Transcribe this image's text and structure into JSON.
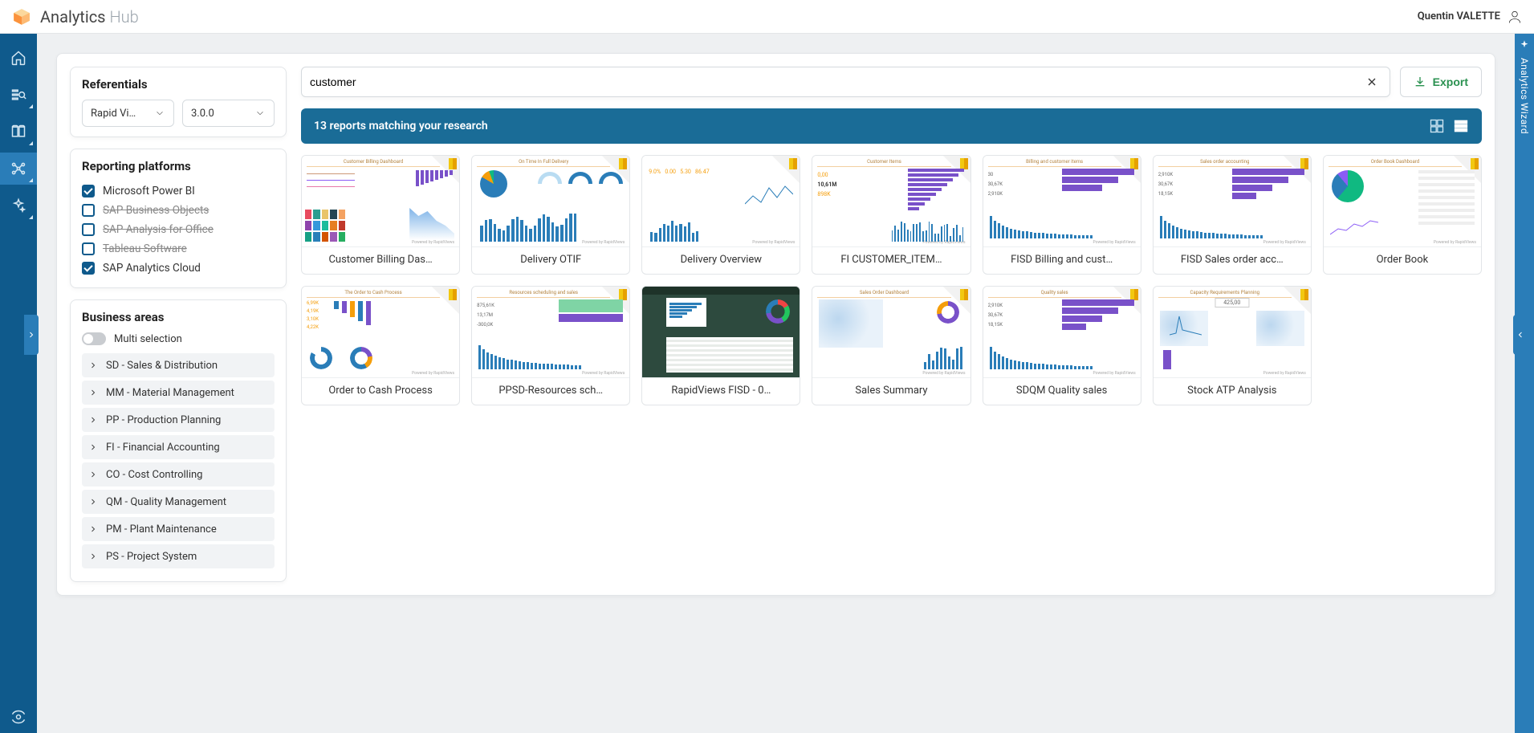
{
  "app": {
    "title_main": "Analytics",
    "title_sub": "Hub"
  },
  "user": {
    "name": "Quentin VALETTE"
  },
  "right_panel": {
    "label": "Analytics Wizard"
  },
  "sidebar": {
    "referentials": {
      "title": "Referentials",
      "select1": "Rapid Vi…",
      "select2": "3.0.0"
    },
    "platforms": {
      "title": "Reporting platforms",
      "items": [
        {
          "label": "Microsoft Power BI",
          "checked": true,
          "disabled": false
        },
        {
          "label": "SAP Business Objects",
          "checked": false,
          "disabled": true
        },
        {
          "label": "SAP Analysis for Office",
          "checked": false,
          "disabled": true
        },
        {
          "label": "Tableau Software",
          "checked": false,
          "disabled": true
        },
        {
          "label": "SAP Analytics Cloud",
          "checked": true,
          "disabled": false
        }
      ]
    },
    "business_areas": {
      "title": "Business areas",
      "multi_label": "Multi selection",
      "items": [
        "SD - Sales & Distribution",
        "MM - Material Management",
        "PP - Production Planning",
        "FI - Financial Accounting",
        "CO - Cost Controlling",
        "QM - Quality Management",
        "PM - Plant Maintenance",
        "PS - Project System"
      ]
    }
  },
  "search": {
    "value": "customer"
  },
  "export": {
    "label": "Export"
  },
  "results": {
    "count_text": "13 reports matching your research"
  },
  "reports": [
    {
      "title": "Customer Billing Das…",
      "thumb_header": "Customer Billing Dashboard"
    },
    {
      "title": "Delivery OTIF",
      "thumb_header": "On Time In Full Delivery"
    },
    {
      "title": "Delivery Overview",
      "thumb_header": ""
    },
    {
      "title": "FI CUSTOMER_ITEM…",
      "thumb_header": "Customer Items"
    },
    {
      "title": "FISD Billing and cust…",
      "thumb_header": "Billing and customer items"
    },
    {
      "title": "FISD Sales order acc…",
      "thumb_header": "Sales order accounting"
    },
    {
      "title": "Order Book",
      "thumb_header": "Order Book Dashboard"
    },
    {
      "title": "Order to Cash Process",
      "thumb_header": "The Order to Cash Process"
    },
    {
      "title": "PPSD-Resources sch…",
      "thumb_header": "Resources scheduling and sales"
    },
    {
      "title": "RapidViews FISD - 0…",
      "thumb_header": ""
    },
    {
      "title": "Sales Summary",
      "thumb_header": "Sales Order Dashboard"
    },
    {
      "title": "SDQM Quality sales",
      "thumb_header": "Quality sales"
    },
    {
      "title": "Stock ATP Analysis",
      "thumb_header": "Capacity Requirements Planning"
    }
  ]
}
